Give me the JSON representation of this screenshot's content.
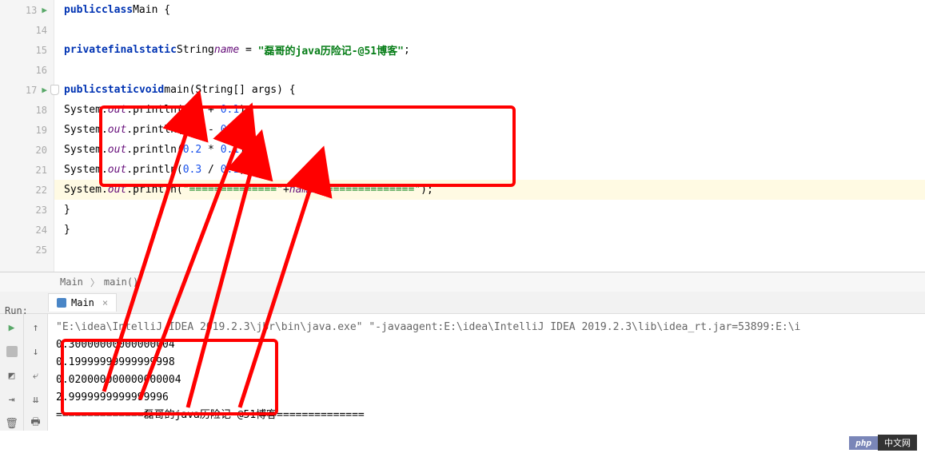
{
  "lines": [
    {
      "num": "13",
      "run": true
    },
    {
      "num": "14"
    },
    {
      "num": "15"
    },
    {
      "num": "16"
    },
    {
      "num": "17",
      "run": true,
      "fold": true
    },
    {
      "num": "18"
    },
    {
      "num": "19"
    },
    {
      "num": "20"
    },
    {
      "num": "21"
    },
    {
      "num": "22",
      "hl": true
    },
    {
      "num": "23"
    },
    {
      "num": "24"
    },
    {
      "num": "25"
    }
  ],
  "code": {
    "class_decl": {
      "kw_public": "public",
      "kw_class": "class",
      "name": "Main",
      "brace": " {"
    },
    "field": {
      "kw_private": "private",
      "kw_final": "final",
      "kw_static": "static",
      "type": "String",
      "name": "name",
      "eq": " = ",
      "value": "\"磊哥的java历险记-@51博客\"",
      "semi": ";"
    },
    "main": {
      "kw_public": "public",
      "kw_static": "static",
      "kw_void": "void",
      "name": "main",
      "params": "(String[] args) {"
    },
    "println1": {
      "prefix": "System.",
      "out": "out",
      "method": ".println(",
      "a": "0.2",
      "op": " + ",
      "b": "0.1",
      "end": ");"
    },
    "println2": {
      "prefix": "System.",
      "out": "out",
      "method": ".println(",
      "a": "0.3",
      "op": " - ",
      "b": "0.1",
      "end": ");"
    },
    "println3": {
      "prefix": "System.",
      "out": "out",
      "method": ".println(",
      "a": "0.2",
      "op": " * ",
      "b": "0.1",
      "end": ");"
    },
    "println4": {
      "prefix": "System.",
      "out": "out",
      "method": ".println(",
      "a": "0.3",
      "op": " / ",
      "b": "0.1",
      "end": ");"
    },
    "println5": {
      "prefix": "System.",
      "out": "out",
      "method": ".println(",
      "s1": "\"==============\"",
      "plus1": "+",
      "name": "name",
      "plus2": "+",
      "s2": "\"==============\"",
      "end": ");"
    },
    "close1": "}",
    "close2": "}"
  },
  "breadcrumb": {
    "c1": "Main",
    "c2": "main()"
  },
  "run": {
    "label": "Run:",
    "tab": "Main",
    "cmd": "\"E:\\idea\\IntelliJ IDEA 2019.2.3\\jbr\\bin\\java.exe\" \"-javaagent:E:\\idea\\IntelliJ IDEA 2019.2.3\\lib\\idea_rt.jar=53899:E:\\i",
    "out1": "0.30000000000000004",
    "out2": "0.19999999999999998",
    "out3": "0.020000000000000004",
    "out4": "2.9999999999999996",
    "out5": "==============磊哥的java历险记-@51博客=============="
  },
  "watermark": {
    "php": "php",
    "cn": "中文网"
  }
}
